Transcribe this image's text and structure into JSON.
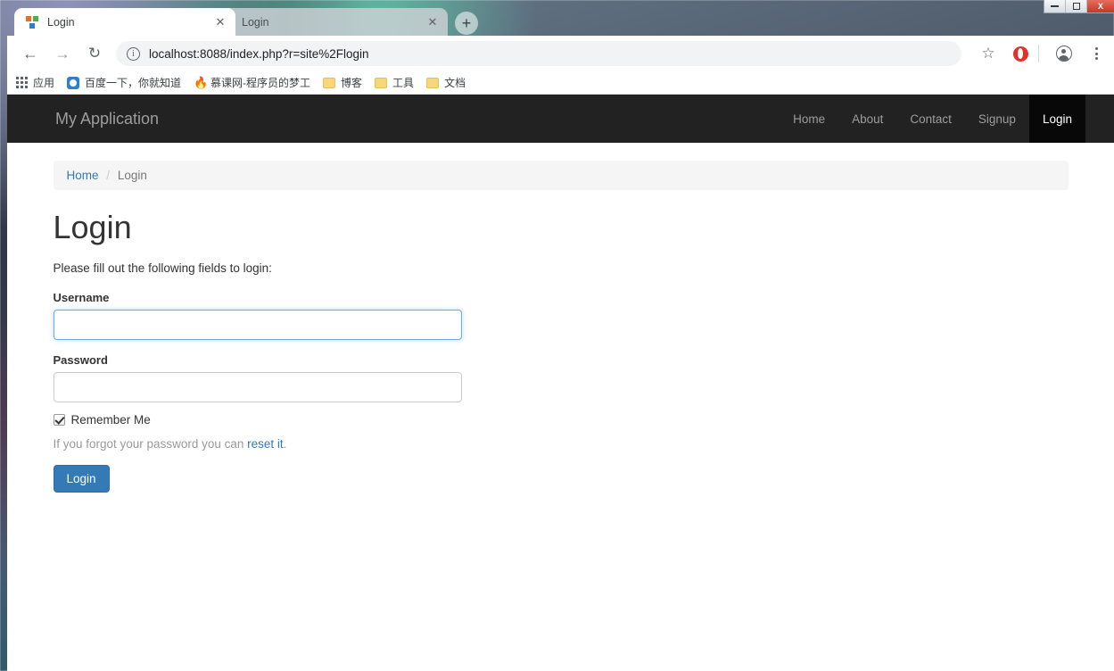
{
  "browser": {
    "tabs": [
      {
        "title": "Login",
        "favicon": "app-squares-icon",
        "active": true
      },
      {
        "title": "Login",
        "favicon": "app-squares-icon",
        "active": false
      }
    ],
    "new_tab_label": "+",
    "window_controls": {
      "minimize": "minimize-icon",
      "maximize": "maximize-icon",
      "close_label": "X"
    },
    "toolbar": {
      "back_label": "←",
      "forward_label": "→",
      "reload_label": "↻",
      "info_label": "i",
      "url": "localhost:8088/index.php?r=site%2Flogin",
      "bookmark_star_label": "☆",
      "extension_icon": "opera-extension-icon",
      "profile_icon": "profile-avatar-icon",
      "menu_icon": "three-dot-menu-icon"
    },
    "bookmarks": [
      {
        "label": "应用",
        "icon": "apps-grid-icon"
      },
      {
        "label": "百度一下，你就知道",
        "icon": "baidu-icon"
      },
      {
        "label": "慕课网-程序员的梦工",
        "icon": "flame-icon"
      },
      {
        "label": "博客",
        "icon": "folder-icon"
      },
      {
        "label": "工具",
        "icon": "folder-icon"
      },
      {
        "label": "文档",
        "icon": "folder-icon"
      }
    ]
  },
  "site": {
    "brand": "My Application",
    "nav": [
      {
        "label": "Home",
        "active": false
      },
      {
        "label": "About",
        "active": false
      },
      {
        "label": "Contact",
        "active": false
      },
      {
        "label": "Signup",
        "active": false
      },
      {
        "label": "Login",
        "active": true
      }
    ],
    "breadcrumb": {
      "home": "Home",
      "separator": "/",
      "current": "Login"
    },
    "page": {
      "title": "Login",
      "lead": "Please fill out the following fields to login:",
      "username": {
        "label": "Username",
        "value": "",
        "placeholder": ""
      },
      "password": {
        "label": "Password",
        "value": "",
        "placeholder": ""
      },
      "remember": {
        "label": "Remember Me",
        "checked": true
      },
      "forgot": {
        "prefix": "If you forgot your password you can ",
        "link": "reset it",
        "suffix": "."
      },
      "submit_label": "Login"
    }
  },
  "colors": {
    "brand_primary": "#337ab7",
    "navbar_bg": "#222222",
    "navbar_active_bg": "#080808",
    "breadcrumb_bg": "#f5f5f5",
    "link": "#337ab7",
    "input_focus_border": "#66afe9"
  }
}
